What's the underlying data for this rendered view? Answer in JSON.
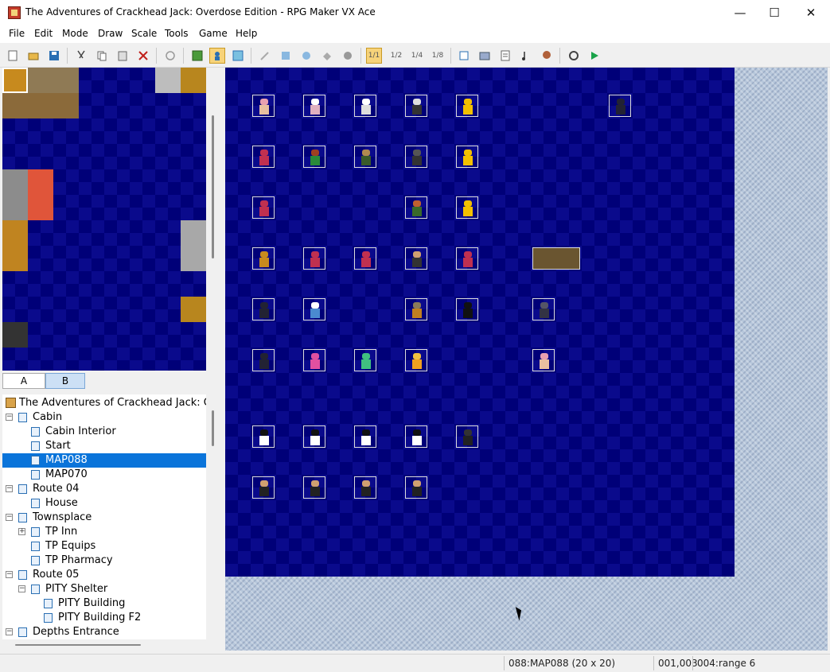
{
  "window": {
    "title": "The Adventures of Crackhead Jack: Overdose Edition - RPG Maker VX Ace",
    "minimize": "—",
    "maximize": "☐",
    "close": "✕"
  },
  "menu": [
    "File",
    "Edit",
    "Mode",
    "Draw",
    "Scale",
    "Tools",
    "Game",
    "Help"
  ],
  "toolbar": {
    "new": "new-project-icon",
    "open": "open-project-icon",
    "save": "save-icon",
    "cut": "cut-icon",
    "copy": "copy-icon",
    "paste": "paste-icon",
    "delete": "delete-icon",
    "undo": "undo-icon",
    "map_mode": "map-mode-icon",
    "event_mode": "event-mode-icon",
    "region_mode": "region-mode-icon",
    "pencil": "pencil-icon",
    "rectangle": "rectangle-icon",
    "ellipse": "ellipse-icon",
    "fill": "fill-icon",
    "shadow": "shadow-pen-icon",
    "scale_1_1": "1/1",
    "scale_1_2": "1/2",
    "scale_1_4": "1/4",
    "scale_1_8": "1/8",
    "database": "database-icon",
    "resources": "resource-manager-icon",
    "script": "script-editor-icon",
    "sound": "sound-test-icon",
    "character": "character-generator-icon",
    "settings": "settings-icon",
    "playtest": "playtest-icon"
  },
  "tabs": {
    "a": "A",
    "b": "B"
  },
  "tree": {
    "project": "The Adventures of Crackhead Jack: O",
    "items": [
      {
        "label": "Cabin",
        "level": 1,
        "toggle": "−"
      },
      {
        "label": "Cabin Interior",
        "level": 2,
        "toggle": ""
      },
      {
        "label": "Start",
        "level": 2,
        "toggle": ""
      },
      {
        "label": "MAP088",
        "level": 2,
        "toggle": "",
        "selected": true
      },
      {
        "label": "MAP070",
        "level": 2,
        "toggle": ""
      },
      {
        "label": "Route 04",
        "level": 1,
        "toggle": "−"
      },
      {
        "label": "House",
        "level": 2,
        "toggle": ""
      },
      {
        "label": "Townsplace",
        "level": 1,
        "toggle": "−"
      },
      {
        "label": "TP Inn",
        "level": 2,
        "toggle": "+"
      },
      {
        "label": "TP Equips",
        "level": 2,
        "toggle": ""
      },
      {
        "label": "TP Pharmacy",
        "level": 2,
        "toggle": ""
      },
      {
        "label": "Route 05",
        "level": 1,
        "toggle": "−"
      },
      {
        "label": "PITY Shelter",
        "level": 2,
        "toggle": "−"
      },
      {
        "label": "PITY Building",
        "level": 3,
        "toggle": ""
      },
      {
        "label": "PITY Building F2",
        "level": 3,
        "toggle": ""
      },
      {
        "label": "Depths Entrance",
        "level": 1,
        "toggle": "−"
      }
    ]
  },
  "status": {
    "map": "088:MAP088 (20 x 20)",
    "coords": "001,003",
    "region": "004:range 6"
  },
  "colors": {
    "selection": "#0a74da",
    "map_bg": "#000078",
    "active_tool": "#f7d37a"
  }
}
